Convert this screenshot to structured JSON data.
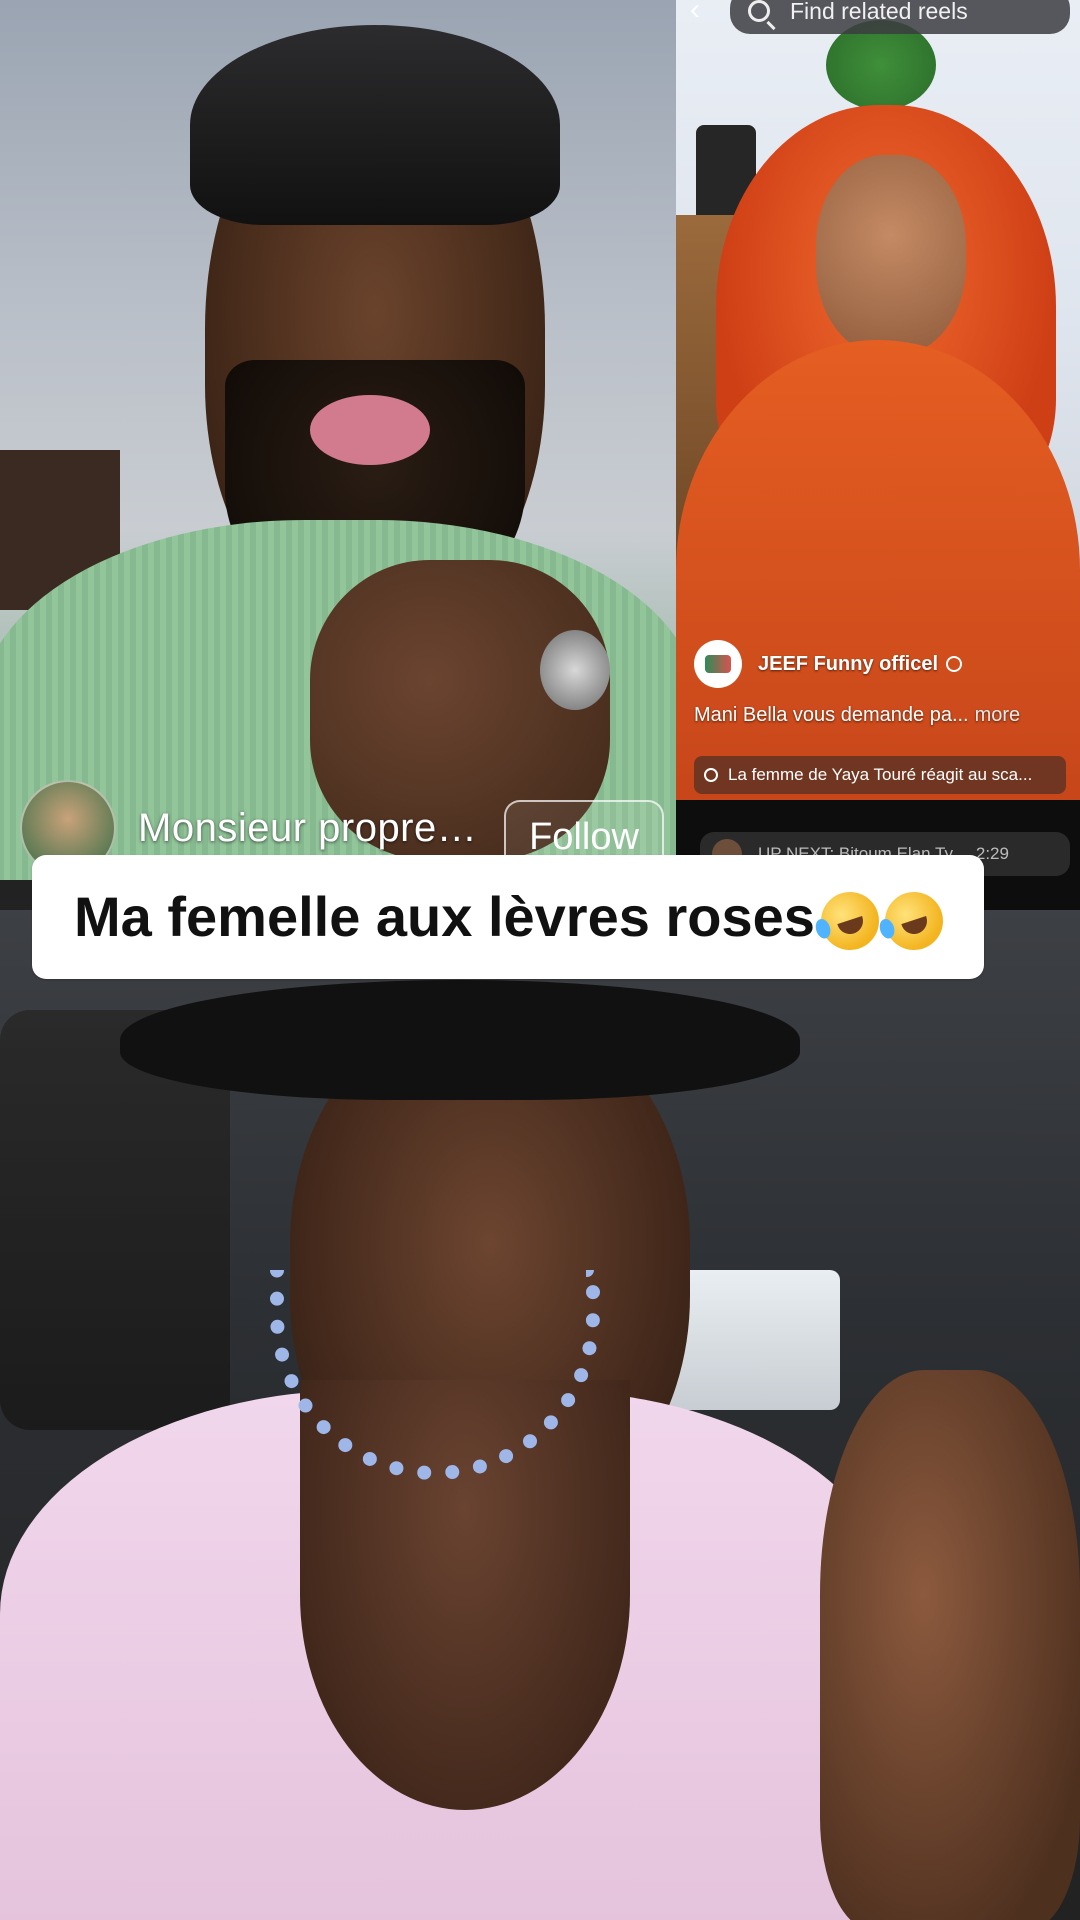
{
  "top_left_video": {
    "creator_name": "Monsieur propre…",
    "follow_label": "Follow"
  },
  "top_right_video": {
    "search_placeholder": "Find related reels",
    "channel_name": "JEEF Funny officel",
    "description": "Mani Bella vous demande pa...",
    "more_label": "more",
    "related_search": "La femme de Yaya Touré réagit au sca..."
  },
  "up_next": {
    "label": "UP NEXT:  Bitoum Elan Ty...",
    "duration": "2:29"
  },
  "caption": {
    "text": "Ma femelle aux lèvres roses"
  },
  "icons": [
    "back-icon",
    "search-icon",
    "globe-icon",
    "emoji-rofl-icon"
  ]
}
